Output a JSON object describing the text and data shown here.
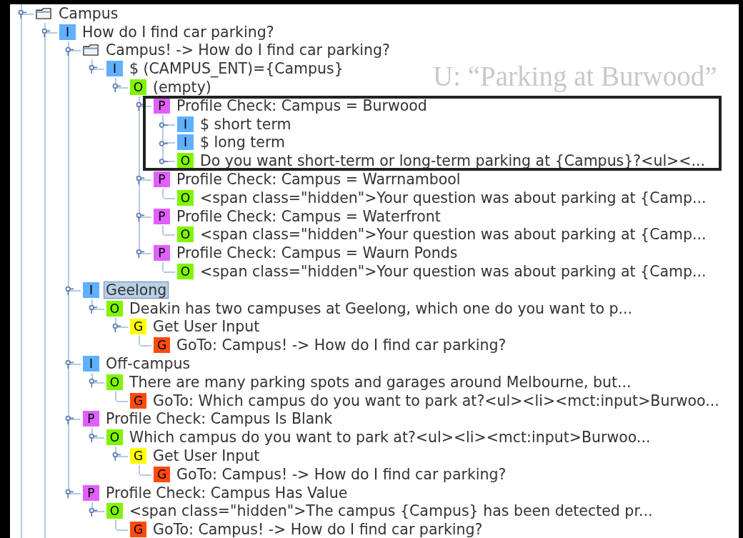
{
  "annotation": {
    "text": "U: “Parking at Burwood”"
  },
  "tree": [
    {
      "kind": "folder",
      "text": "Campus",
      "expanded": true,
      "selected": false,
      "continues": true,
      "children": [
        {
          "kind": "input",
          "badge": "I",
          "text": "How do I find car parking?",
          "expanded": true,
          "selected": false,
          "continues": true,
          "children": [
            {
              "kind": "folder",
              "text": "Campus! -> How do I find car parking?",
              "expanded": true,
              "selected": false,
              "children": [
                {
                  "kind": "input",
                  "badge": "I",
                  "text": "$ (CAMPUS_ENT)={Campus}",
                  "expanded": true,
                  "selected": false,
                  "children": [
                    {
                      "kind": "output",
                      "badge": "O",
                      "text": "(empty)",
                      "expanded": true,
                      "selected": false,
                      "children": [
                        {
                          "kind": "profile",
                          "badge": "P",
                          "text": "Profile Check: Campus = Burwood",
                          "expanded": true,
                          "selected": false,
                          "highlighted": true,
                          "children": [
                            {
                              "kind": "input",
                              "badge": "I",
                              "text": "$ short term",
                              "expanded": false,
                              "selected": false
                            },
                            {
                              "kind": "input",
                              "badge": "I",
                              "text": "$ long term",
                              "expanded": false,
                              "selected": false
                            },
                            {
                              "kind": "output",
                              "badge": "O",
                              "text": "Do you want short-term or long-term parking at {Campus}?<ul><...",
                              "expanded": false,
                              "selected": false
                            }
                          ]
                        },
                        {
                          "kind": "profile",
                          "badge": "P",
                          "text": "Profile Check: Campus = Warrnambool",
                          "expanded": true,
                          "selected": false,
                          "children": [
                            {
                              "kind": "output",
                              "badge": "O",
                              "text": "<span class=\"hidden\">Your question was about parking at {Camp...",
                              "selected": false
                            }
                          ]
                        },
                        {
                          "kind": "profile",
                          "badge": "P",
                          "text": "Profile Check: Campus = Waterfront",
                          "expanded": true,
                          "selected": false,
                          "children": [
                            {
                              "kind": "output",
                              "badge": "O",
                              "text": "<span class=\"hidden\">Your question was about parking at {Camp...",
                              "selected": false
                            }
                          ]
                        },
                        {
                          "kind": "profile",
                          "badge": "P",
                          "text": "Profile Check: Campus = Waurn Ponds",
                          "expanded": true,
                          "selected": false,
                          "children": [
                            {
                              "kind": "output",
                              "badge": "O",
                              "text": "<span class=\"hidden\">Your question was about parking at {Camp...",
                              "selected": false
                            }
                          ]
                        }
                      ]
                    }
                  ]
                }
              ]
            },
            {
              "kind": "input",
              "badge": "I",
              "text": "Geelong",
              "expanded": true,
              "selected": true,
              "children": [
                {
                  "kind": "output",
                  "badge": "O",
                  "text": "Deakin has two campuses at Geelong, which one do you want to p...",
                  "expanded": true,
                  "selected": false,
                  "children": [
                    {
                      "kind": "action",
                      "badge": "G",
                      "text": "Get User Input",
                      "expanded": true,
                      "selected": false,
                      "children": [
                        {
                          "kind": "goto",
                          "badge": "G",
                          "text": "GoTo: Campus! -> How do I find car parking?",
                          "selected": false
                        }
                      ]
                    }
                  ]
                }
              ]
            },
            {
              "kind": "input",
              "badge": "I",
              "text": "Off-campus",
              "expanded": true,
              "selected": false,
              "children": [
                {
                  "kind": "output",
                  "badge": "O",
                  "text": "There are many parking spots and garages around Melbourne, but...",
                  "expanded": true,
                  "selected": false,
                  "children": [
                    {
                      "kind": "goto",
                      "badge": "G",
                      "text": "GoTo: Which campus do you want to park at?<ul><li><mct:input>Burwoo...",
                      "selected": false
                    }
                  ]
                }
              ]
            },
            {
              "kind": "profile",
              "badge": "P",
              "text": "Profile Check: Campus Is Blank",
              "expanded": true,
              "selected": false,
              "children": [
                {
                  "kind": "output",
                  "badge": "O",
                  "text": "Which campus do you want to park at?<ul><li><mct:input>Burwoo...",
                  "expanded": true,
                  "selected": false,
                  "children": [
                    {
                      "kind": "action",
                      "badge": "G",
                      "text": "Get User Input",
                      "expanded": true,
                      "selected": false,
                      "children": [
                        {
                          "kind": "goto",
                          "badge": "G",
                          "text": "GoTo: Campus! -> How do I find car parking?",
                          "selected": false
                        }
                      ]
                    }
                  ]
                }
              ]
            },
            {
              "kind": "profile",
              "badge": "P",
              "text": "Profile Check: Campus Has Value",
              "expanded": true,
              "selected": false,
              "children": [
                {
                  "kind": "output",
                  "badge": "O",
                  "text": "<span class=\"hidden\">The campus {Campus} has been detected pr...",
                  "expanded": true,
                  "selected": false,
                  "children": [
                    {
                      "kind": "goto",
                      "badge": "G",
                      "text": "GoTo: Campus! -> How do I find car parking?",
                      "selected": false
                    }
                  ]
                }
              ]
            }
          ]
        }
      ]
    }
  ]
}
